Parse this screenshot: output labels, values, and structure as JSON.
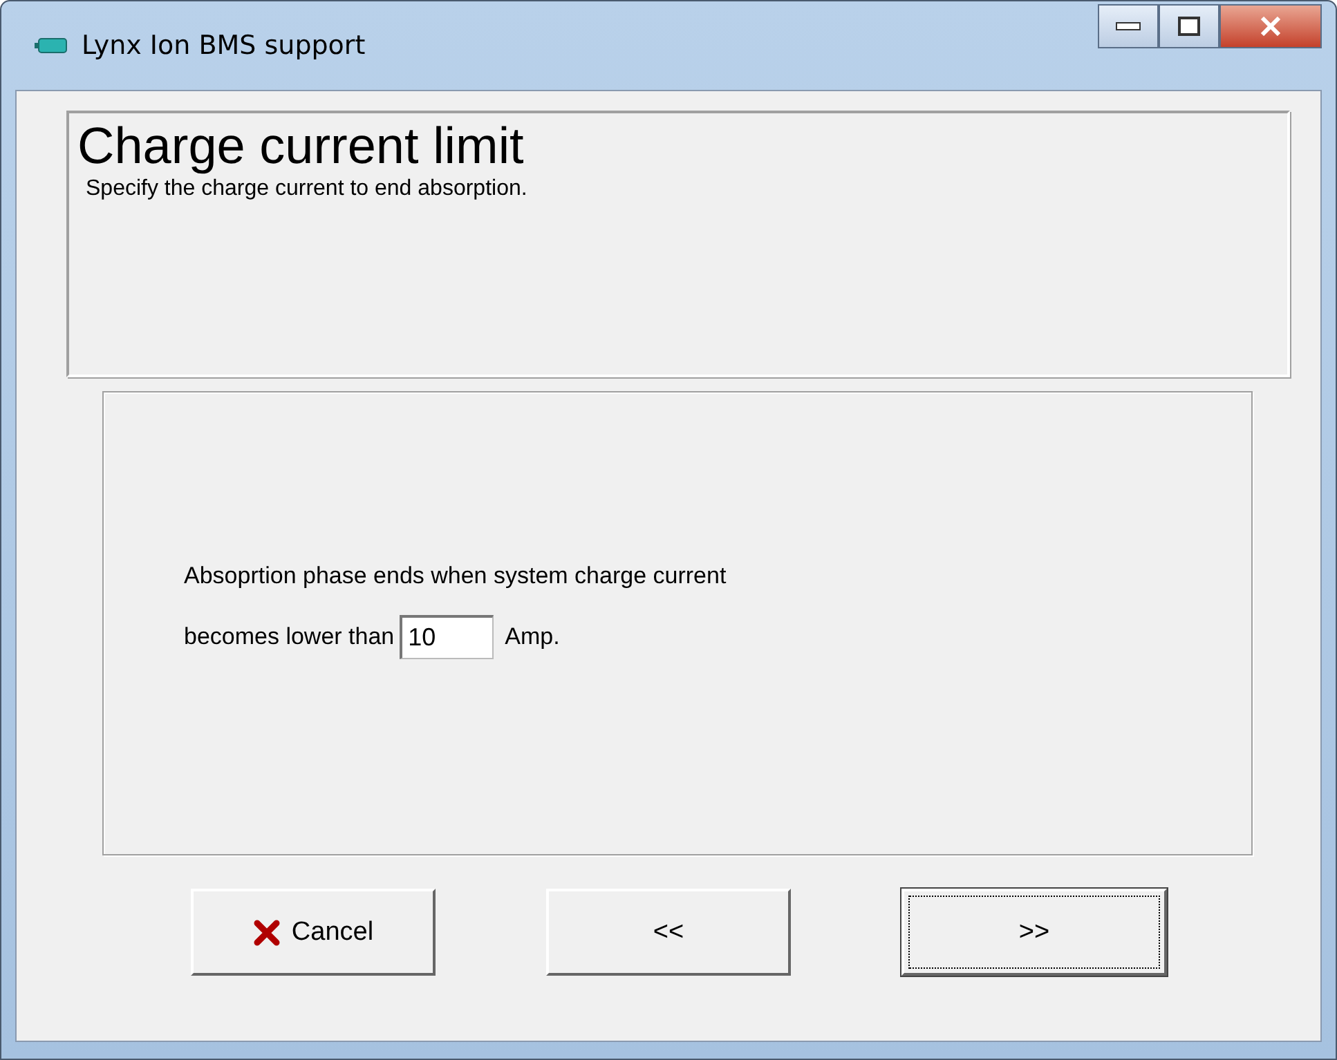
{
  "window": {
    "title": "Lynx Ion BMS support"
  },
  "header": {
    "title": "Charge current limit",
    "subtitle": "Specify the charge current to end absorption."
  },
  "form": {
    "sentence": "Absoprtion phase ends when system charge current",
    "prefix": "becomes lower than",
    "value": "10",
    "unit": "Amp."
  },
  "buttons": [
    {
      "label": "Cancel",
      "kind": "cancel",
      "focused": false
    },
    {
      "label": "<<",
      "kind": "plain",
      "focused": false
    },
    {
      "label": ">>",
      "kind": "plain",
      "focused": true
    }
  ]
}
